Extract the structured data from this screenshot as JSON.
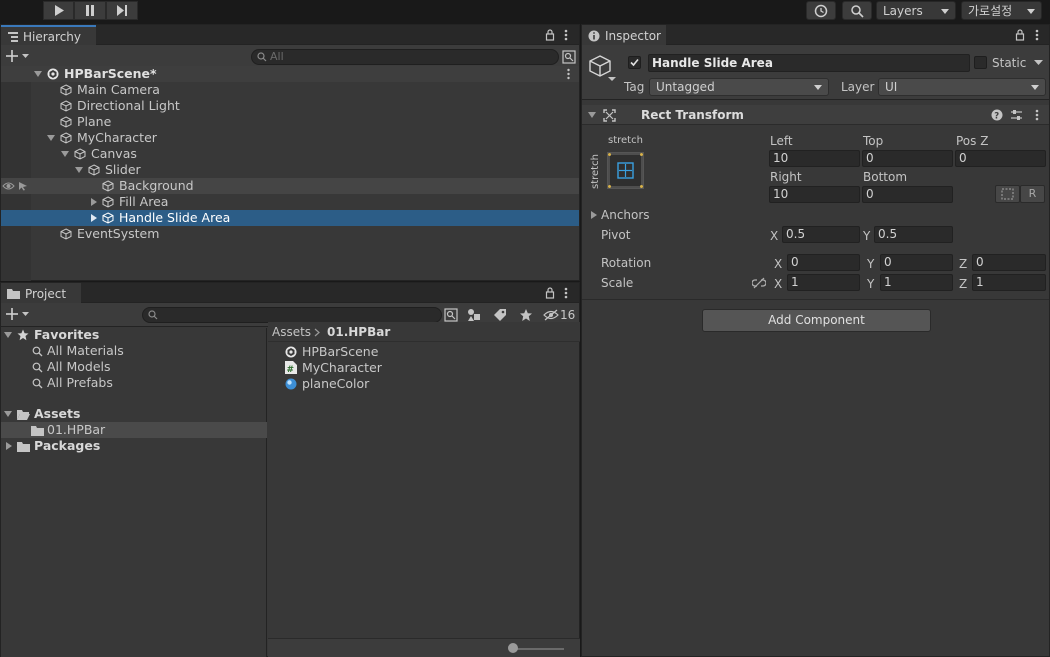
{
  "toolbar": {
    "play_icon": "play-icon",
    "pause_icon": "pause-icon",
    "step_icon": "step-icon",
    "layers_label": "Layers",
    "layout_label": "가로설정"
  },
  "hierarchy": {
    "tab_label": "Hierarchy",
    "search_placeholder": "All",
    "scene_name": "HPBarScene*",
    "items": [
      {
        "label": "Main Camera"
      },
      {
        "label": "Directional Light"
      },
      {
        "label": "Plane"
      },
      {
        "label": "MyCharacter"
      },
      {
        "label": "Canvas"
      },
      {
        "label": "Slider"
      },
      {
        "label": "Background"
      },
      {
        "label": "Fill Area"
      },
      {
        "label": "Handle Slide Area"
      },
      {
        "label": "EventSystem"
      }
    ]
  },
  "project": {
    "tab_label": "Project",
    "hidden_count": "16",
    "favorites_label": "Favorites",
    "favorites": [
      {
        "label": "All Materials"
      },
      {
        "label": "All Models"
      },
      {
        "label": "All Prefabs"
      }
    ],
    "assets_label": "Assets",
    "assets_children": [
      {
        "label": "01.HPBar"
      }
    ],
    "packages_label": "Packages",
    "breadcrumb_root": "Assets",
    "breadcrumb_current": "01.HPBar",
    "files": [
      {
        "label": "HPBarScene",
        "icon": "unity-scene-icon"
      },
      {
        "label": "MyCharacter",
        "icon": "csharp-script-icon"
      },
      {
        "label": "planeColor",
        "icon": "material-sphere-icon"
      }
    ]
  },
  "inspector": {
    "tab_label": "Inspector",
    "object_name": "Handle Slide Area",
    "static_label": "Static",
    "tag_label": "Tag",
    "tag_value": "Untagged",
    "layer_label": "Layer",
    "layer_value": "UI",
    "component_title": "Rect Transform",
    "stretch_h": "stretch",
    "stretch_v": "stretch",
    "left_label": "Left",
    "left_value": "10",
    "top_label": "Top",
    "top_value": "0",
    "posz_label": "Pos Z",
    "posz_value": "0",
    "right_label": "Right",
    "right_value": "10",
    "bottom_label": "Bottom",
    "bottom_value": "0",
    "r_button": "R",
    "anchors_label": "Anchors",
    "pivot_label": "Pivot",
    "pivot_x": "0.5",
    "pivot_y": "0.5",
    "rotation_label": "Rotation",
    "rotation_x": "0",
    "rotation_y": "0",
    "rotation_z": "0",
    "scale_label": "Scale",
    "scale_x": "1",
    "scale_y": "1",
    "scale_z": "1",
    "x_label": "X",
    "y_label": "Y",
    "z_label": "Z",
    "add_component": "Add Component"
  }
}
